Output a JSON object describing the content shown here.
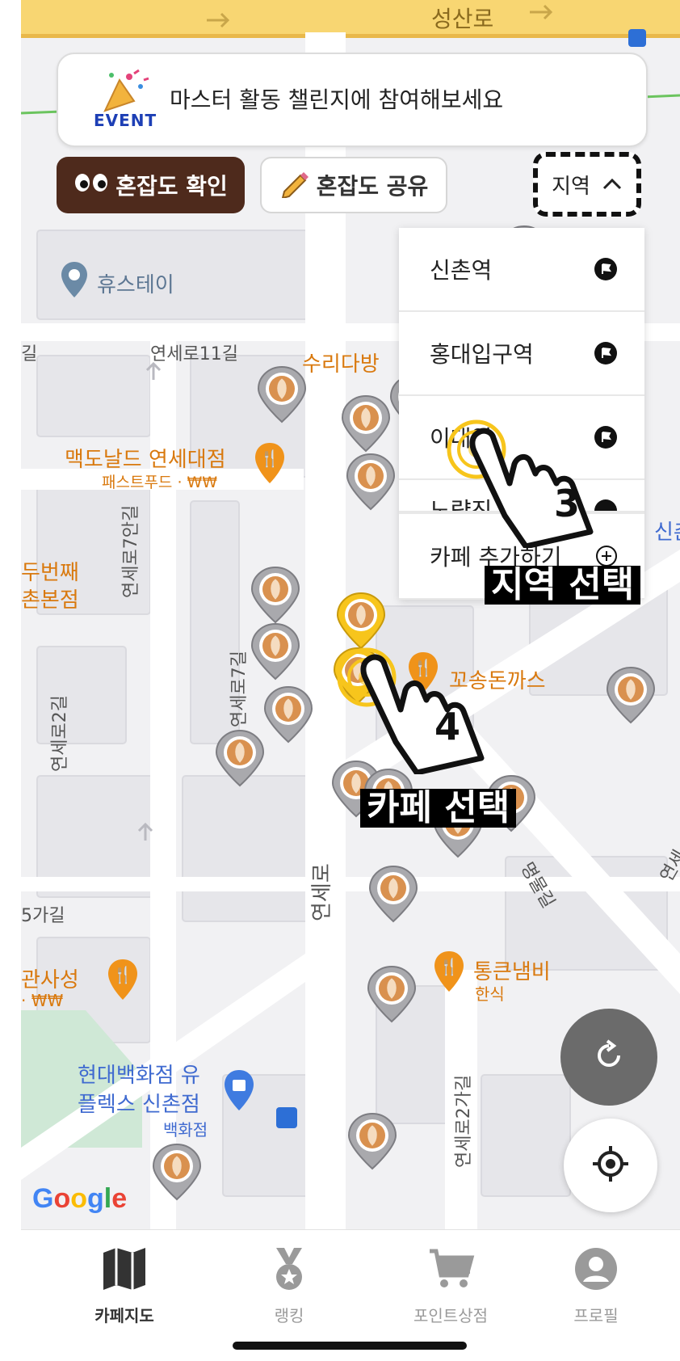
{
  "status_bar": {
    "road_name": "성산로"
  },
  "event_banner": {
    "badge": "EVENT",
    "text": "마스터 활동 챌린지에 참여해보세요"
  },
  "actions": {
    "congestion_check": "혼잡도 확인",
    "congestion_share": "혼잡도 공유",
    "region": "지역"
  },
  "region_dropdown": {
    "items": [
      "신촌역",
      "홍대입구역",
      "이대역",
      "노량진"
    ],
    "add_cafe": "카페 추가하기"
  },
  "tutorial": {
    "step3_number": "3",
    "step3_caption": "지역 선택",
    "step4_number": "4",
    "step4_caption": "카페 선택"
  },
  "map": {
    "places": {
      "hue_stay": "휴스테이",
      "suri_dabang": "수리다방",
      "mcdonalds": "맥도날드 연세대점",
      "mcdonalds_sub": "패스트푸드 · ₩₩",
      "second_place_1": "두번째",
      "second_place_2": "촌본점",
      "kkosong": "꼬송돈까스",
      "tongkeun": "통큰냄비",
      "tongkeun_sub": "한식",
      "hyundai_1": "현대백화점 유",
      "hyundai_2": "플렉스 신촌점",
      "hyundai_sub": "백화점",
      "gwansa_1": "관사성",
      "gwansa_2": "· ₩₩",
      "sinchon_edge": "신촌"
    },
    "roads": {
      "yonsei11": "연세로11길",
      "yonsei7an": "연세로7안길",
      "yonsei7": "연세로7길",
      "yonsei2": "연세로2길",
      "yonseiro": "연세로",
      "myeongmul": "명물길",
      "yonsei2ga": "연세로2가길",
      "five_ga": "5가길",
      "gil": "길",
      "yonsei_edge": "연세"
    },
    "google": "Google"
  },
  "bottom_nav": {
    "tabs": [
      {
        "label": "카페지도",
        "icon": "map-icon",
        "active": true
      },
      {
        "label": "랭킹",
        "icon": "medal-icon",
        "active": false
      },
      {
        "label": "포인트상점",
        "icon": "cart-icon",
        "active": false
      },
      {
        "label": "프로필",
        "icon": "profile-icon",
        "active": false
      }
    ]
  },
  "colors": {
    "brand_brown": "#4e2a1c",
    "highlight_yellow": "#f7c51c",
    "poi_orange": "#e8830c"
  }
}
